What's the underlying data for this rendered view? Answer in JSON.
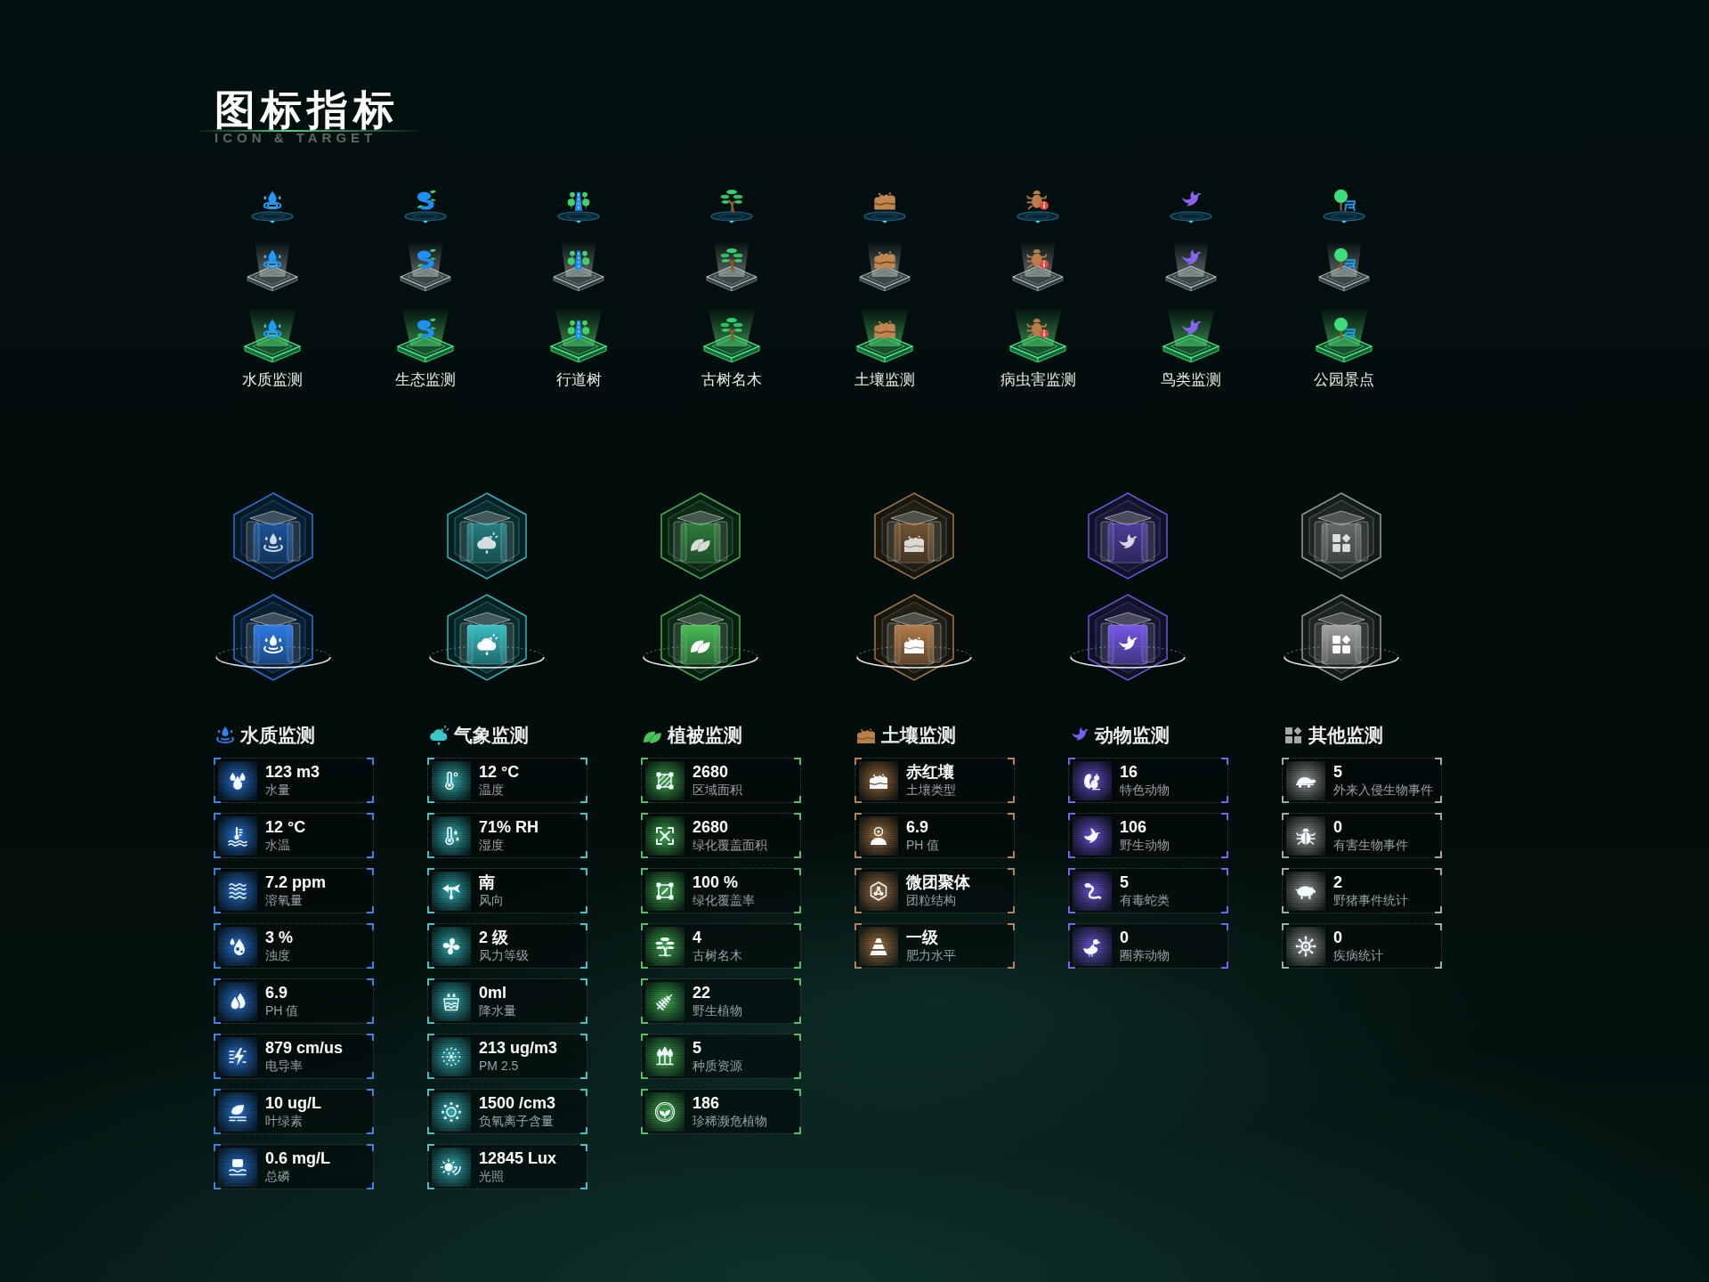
{
  "header": {
    "title": "图标指标",
    "subtitle": "ICON & TARGET"
  },
  "icon_set": [
    {
      "label": "水质监测"
    },
    {
      "label": "生态监测"
    },
    {
      "label": "行道树"
    },
    {
      "label": "古树名木"
    },
    {
      "label": "土壤监测"
    },
    {
      "label": "病虫害监测"
    },
    {
      "label": "鸟类监测"
    },
    {
      "label": "公园景点"
    }
  ],
  "categories": [
    {
      "title": "水质监测",
      "color": "#2f80f0",
      "metrics": [
        {
          "value": "123 m3",
          "label": "水量"
        },
        {
          "value": "12 °C",
          "label": "水温"
        },
        {
          "value": "7.2 ppm",
          "label": "溶氧量"
        },
        {
          "value": "3 %",
          "label": "浊度"
        },
        {
          "value": "6.9",
          "label": "PH 值"
        },
        {
          "value": "879 cm/us",
          "label": "电导率"
        },
        {
          "value": "10 ug/L",
          "label": "叶绿素"
        },
        {
          "value": "0.6 mg/L",
          "label": "总磷"
        }
      ]
    },
    {
      "title": "气象监测",
      "color": "#3cc6cc",
      "metrics": [
        {
          "value": "12 °C",
          "label": "温度"
        },
        {
          "value": "71% RH",
          "label": "湿度"
        },
        {
          "value": "南",
          "label": "风向"
        },
        {
          "value": "2 级",
          "label": "风力等级"
        },
        {
          "value": "0ml",
          "label": "降水量"
        },
        {
          "value": "213 ug/m3",
          "label": "PM 2.5"
        },
        {
          "value": "1500 /cm3",
          "label": "负氧离子含量"
        },
        {
          "value": "12845 Lux",
          "label": "光照"
        }
      ]
    },
    {
      "title": "植被监测",
      "color": "#4cc35a",
      "metrics": [
        {
          "value": "2680",
          "label": "区域面积"
        },
        {
          "value": "2680",
          "label": "绿化覆盖面积"
        },
        {
          "value": "100 %",
          "label": "绿化覆盖率"
        },
        {
          "value": "4",
          "label": "古树名木"
        },
        {
          "value": "22",
          "label": "野生植物"
        },
        {
          "value": "5",
          "label": "种质资源"
        },
        {
          "value": "186",
          "label": "珍稀濒危植物"
        }
      ]
    },
    {
      "title": "土壤监测",
      "color": "#b9804c",
      "metrics": [
        {
          "value": "赤红壤",
          "label": "土壤类型"
        },
        {
          "value": "6.9",
          "label": "PH 值"
        },
        {
          "value": "微团聚体",
          "label": "团粒结构"
        },
        {
          "value": "一级",
          "label": "肥力水平"
        }
      ]
    },
    {
      "title": "动物监测",
      "color": "#7b5cf2",
      "metrics": [
        {
          "value": "16",
          "label": "特色动物"
        },
        {
          "value": "106",
          "label": "野生动物"
        },
        {
          "value": "5",
          "label": "有毒蛇类"
        },
        {
          "value": "0",
          "label": "圈养动物"
        }
      ]
    },
    {
      "title": "其他监测",
      "color": "#a8a8a8",
      "metrics": [
        {
          "value": "5",
          "label": "外来入侵生物事件"
        },
        {
          "value": "0",
          "label": "有害生物事件"
        },
        {
          "value": "2",
          "label": "野猪事件统计"
        },
        {
          "value": "0",
          "label": "疾病统计"
        }
      ]
    }
  ]
}
